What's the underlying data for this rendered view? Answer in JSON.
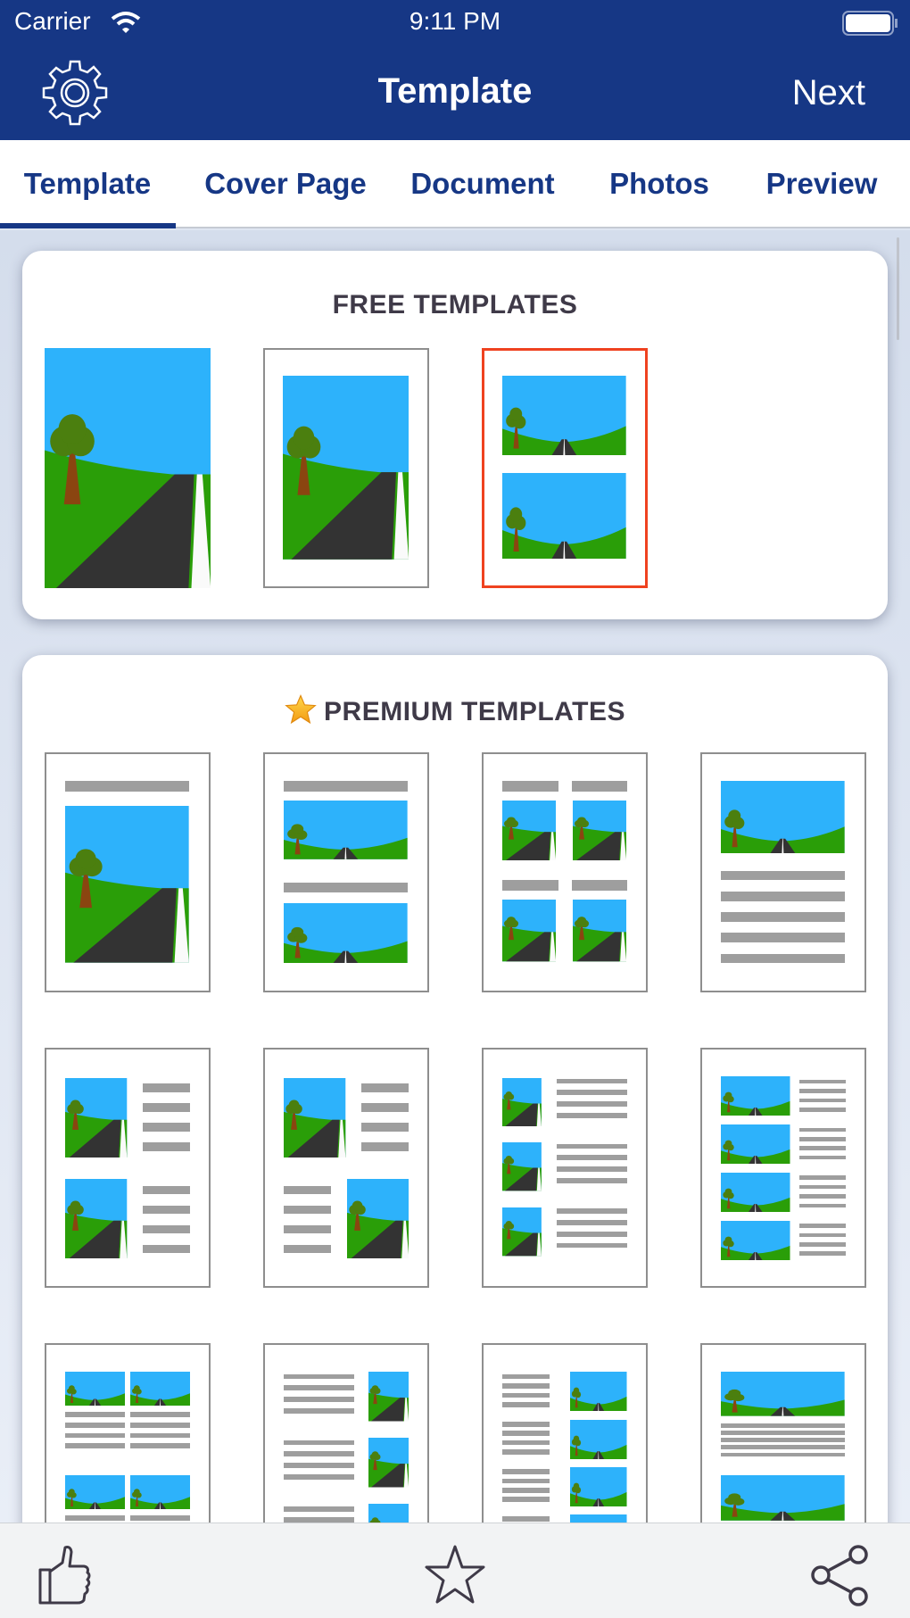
{
  "status_bar": {
    "carrier": "Carrier",
    "time": "9:11 PM"
  },
  "nav": {
    "title": "Template",
    "next_label": "Next",
    "settings_icon": "gear-icon"
  },
  "tabs": [
    {
      "label": "Template",
      "active": true
    },
    {
      "label": "Cover Page",
      "active": false
    },
    {
      "label": "Document",
      "active": false
    },
    {
      "label": "Photos",
      "active": false
    },
    {
      "label": "Preview",
      "active": false
    }
  ],
  "free_section": {
    "title": "FREE TEMPLATES",
    "template_count": 3,
    "selected_index": 2
  },
  "premium_section": {
    "title": "PREMIUM TEMPLATES",
    "icon": "star-icon",
    "visible_template_count": 12
  },
  "bottom_bar": {
    "icons": [
      "thumbs-up-icon",
      "star-outline-icon",
      "share-icon"
    ]
  },
  "colors": {
    "brand": "#163785",
    "selected": "#ef4220",
    "sky": "#2db2fb",
    "grass": "#2a9e08"
  }
}
